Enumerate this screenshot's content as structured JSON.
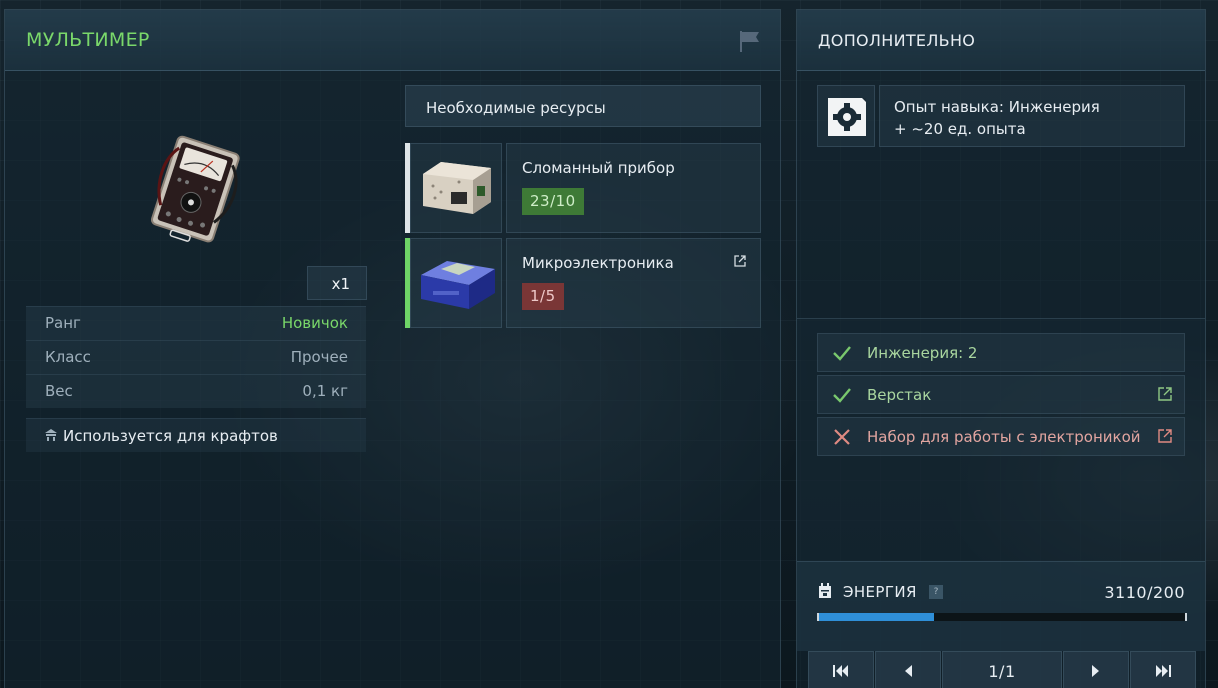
{
  "item": {
    "title": "МУЛЬТИМЕР",
    "quantity": "x1",
    "properties": [
      {
        "key": "Ранг",
        "value": "Новичок"
      },
      {
        "key": "Класс",
        "value": "Прочее"
      },
      {
        "key": "Вес",
        "value": "0,1 кг"
      }
    ],
    "used_for": "Используется для крафтов"
  },
  "resources": {
    "header": "Необходимые ресурсы",
    "items": [
      {
        "name": "Сломанный прибор",
        "count": "23/10"
      },
      {
        "name": "Микроэлектроника",
        "count": "1/5"
      }
    ]
  },
  "additional": {
    "title": "ДОПОЛНИТЕЛЬНО",
    "xp_line1": "Опыт навыка: Инженерия",
    "xp_line2": "+ ~20 ед. опыта",
    "requirements": [
      {
        "label": "Инженерия: 2"
      },
      {
        "label": "Верстак"
      },
      {
        "label": "Набор для работы с электроникой"
      }
    ]
  },
  "energy": {
    "label": "ЭНЕРГИЯ",
    "help": "?",
    "value": "3110/200"
  },
  "pager": {
    "indicator": "1/1"
  },
  "colors": {
    "accent_green": "#7ad86a",
    "ok_badge": "#3e7a36",
    "bad_badge": "#7a3636",
    "energy_fill": "#2f8fd8"
  }
}
